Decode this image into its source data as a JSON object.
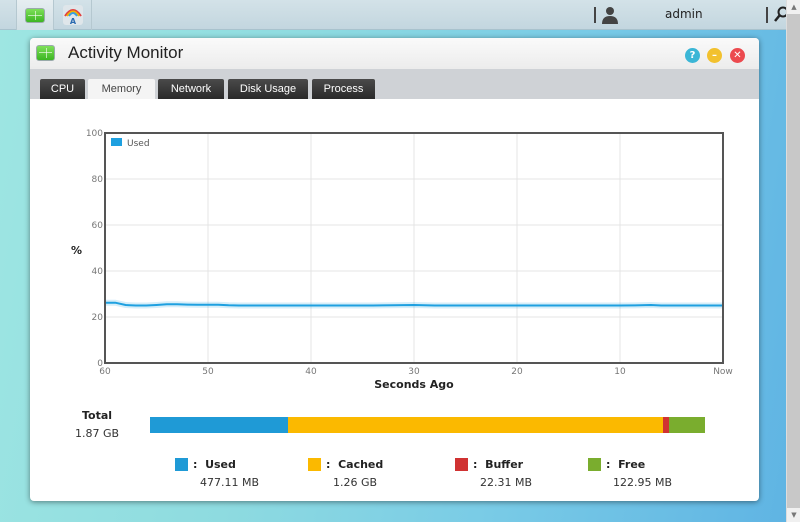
{
  "taskbar": {
    "apps": [
      {
        "name": "Activity Monitor",
        "icon": "activity-monitor-icon",
        "active": true
      },
      {
        "name": "App Center",
        "icon": "app-center-icon",
        "active": false
      }
    ],
    "username": "admin",
    "user_icon": "user-icon",
    "search_icon": "search-icon"
  },
  "window": {
    "title": "Activity Monitor",
    "icon": "activity-monitor-icon",
    "buttons": {
      "help": {
        "icon": "help-icon",
        "glyph": "?",
        "color": "#3bb6d6"
      },
      "minimize": {
        "icon": "minimize-icon",
        "glyph": "–",
        "color": "#f2c12e"
      },
      "close": {
        "icon": "close-icon",
        "glyph": "✕",
        "color": "#ec4a4f"
      }
    },
    "tabs": [
      {
        "label": "CPU",
        "active": false
      },
      {
        "label": "Memory",
        "active": true
      },
      {
        "label": "Network",
        "active": false
      },
      {
        "label": "Disk Usage",
        "active": false
      },
      {
        "label": "Process",
        "active": false
      }
    ]
  },
  "chart_data": {
    "type": "area",
    "title": "",
    "xlabel": "Seconds Ago",
    "ylabel": "%",
    "ylim": [
      0,
      100
    ],
    "xlim": [
      60,
      0
    ],
    "yticks": [
      "0",
      "20",
      "40",
      "60",
      "80",
      "100"
    ],
    "xticks": [
      {
        "value": 60,
        "label": "60"
      },
      {
        "value": 50,
        "label": "50"
      },
      {
        "value": 40,
        "label": "40"
      },
      {
        "value": 30,
        "label": "30"
      },
      {
        "value": 20,
        "label": "20"
      },
      {
        "value": 10,
        "label": "10"
      },
      {
        "value": 0,
        "label": "Now"
      }
    ],
    "grid": true,
    "legend": {
      "position": "top-left"
    },
    "series": [
      {
        "name": "Used",
        "color": "#1ea0e0",
        "x": [
          60,
          59,
          58,
          57,
          56,
          55,
          54,
          53,
          52,
          51,
          50,
          49,
          48,
          47,
          46,
          45,
          44,
          43,
          42,
          41,
          40,
          38,
          36,
          34,
          32,
          30,
          28,
          26,
          24,
          22,
          20,
          18,
          16,
          14,
          12,
          10,
          8,
          7,
          6,
          4,
          2,
          0
        ],
        "values": [
          26.2,
          26.2,
          25.2,
          25.0,
          25.0,
          25.2,
          25.5,
          25.5,
          25.4,
          25.3,
          25.3,
          25.3,
          25.1,
          25.0,
          25.0,
          25.0,
          25.0,
          25.0,
          25.0,
          25.0,
          25.0,
          25.0,
          25.0,
          25.0,
          25.1,
          25.2,
          25.0,
          25.0,
          25.0,
          25.0,
          25.0,
          25.0,
          25.0,
          25.0,
          25.0,
          25.0,
          25.1,
          25.2,
          25.0,
          25.0,
          25.0,
          25.0
        ]
      }
    ]
  },
  "memory": {
    "total_label": "Total",
    "total_value": "1.87 GB",
    "segments": [
      {
        "name": "Used",
        "value": "477.11 MB",
        "mb": 477.11,
        "color": "#1f9ad6"
      },
      {
        "name": "Cached",
        "value": "1.26 GB",
        "mb": 1290.24,
        "color": "#fbb900"
      },
      {
        "name": "Buffer",
        "value": "22.31 MB",
        "mb": 22.31,
        "color": "#d03232"
      },
      {
        "name": "Free",
        "value": "122.95 MB",
        "mb": 122.95,
        "color": "#7aad2e"
      }
    ],
    "separator": ":"
  }
}
